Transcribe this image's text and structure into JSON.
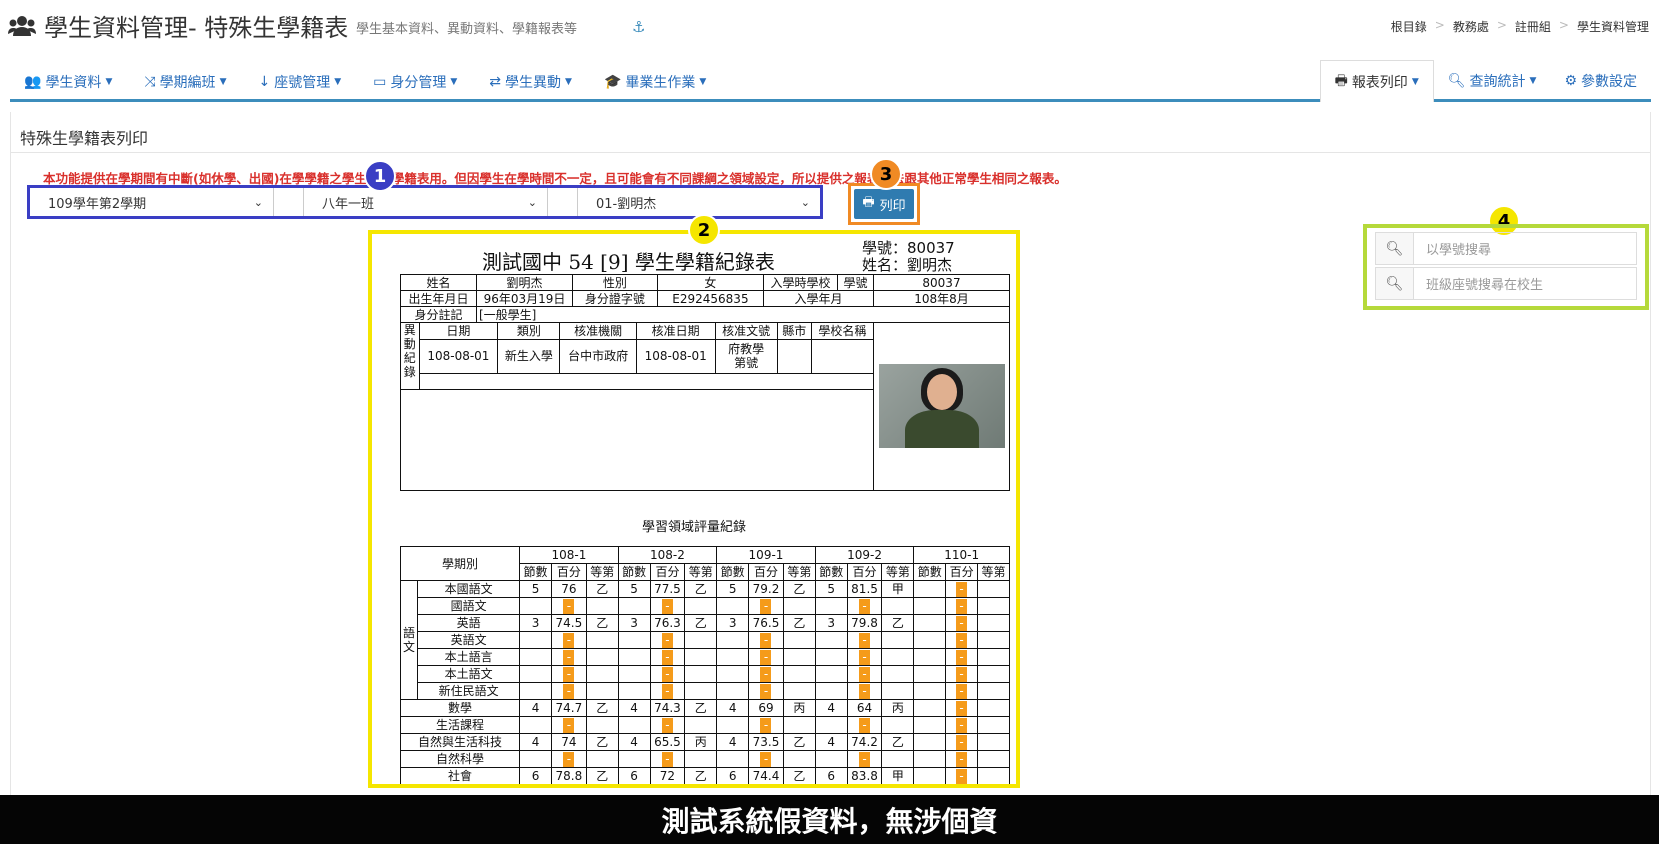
{
  "header": {
    "title": "學生資料管理- 特殊生學籍表",
    "subtitle": "學生基本資料、異動資料、學籍報表等",
    "breadcrumb": [
      "根目錄",
      "教務處",
      "註冊組",
      "學生資料管理"
    ]
  },
  "nav": {
    "left": [
      "學生資料",
      "學期編班",
      "座號管理",
      "身分管理",
      "學生異動",
      "畢業生作業"
    ],
    "right": [
      "報表列印",
      "查詢統計",
      "參數設定"
    ]
  },
  "panel": {
    "title": "特殊生學籍表列印",
    "notice": "本功能提供在學期間有中斷(如休學、出國)在學學籍之學生列印學籍表用。但因學生在學時間不一定，且可能會有不同課綱之領域設定，所以提供之報表無法跟其他正常學生相同之報表。",
    "selects": {
      "term": "109學年第2學期",
      "class": "八年一班",
      "student": "01-劉明杰"
    },
    "print_label": "列印",
    "search": {
      "by_id": "以學號搜尋",
      "by_seat": "班級座號搜尋在校生"
    }
  },
  "badges": [
    "1",
    "2",
    "3",
    "4"
  ],
  "doc": {
    "title": "測試國中 54 [9] 學生學籍紀錄表",
    "id_line": "學號：80037",
    "name_line": "姓名：劉明杰",
    "basic": {
      "name_label": "姓名",
      "name": "劉明杰",
      "sex_label": "性別",
      "sex": "女",
      "school_label": "入學時學校",
      "id_label": "學號",
      "id": "80037",
      "birth_label": "出生年月日",
      "birth": "96年03月19日",
      "idno_label": "身分證字號",
      "idno": "E292456835",
      "enroll_label": "入學年月",
      "enroll": "108年8月",
      "status_label": "身分註記",
      "status": "[一般學生]"
    },
    "change": {
      "side": [
        "異",
        "動",
        "紀",
        "錄"
      ],
      "headers": [
        "日期",
        "類別",
        "核准機關",
        "核准日期",
        "核准文號",
        "縣市",
        "學校名稱"
      ],
      "row": [
        "108-08-01",
        "新生入學",
        "台中市政府",
        "108-08-01",
        "府教學\n第號",
        "",
        ""
      ]
    },
    "grades_title": "學習領域評量紀錄",
    "grades": {
      "term_label": "學期別",
      "terms": [
        "108-1",
        "108-2",
        "109-1",
        "109-2",
        "110-1"
      ],
      "sub": [
        "節數",
        "百分",
        "等第"
      ],
      "group_label": "語文",
      "rows": [
        {
          "name": "本國語文",
          "g": true,
          "v": [
            [
              "5",
              "76",
              "乙"
            ],
            [
              "5",
              "77.5",
              "乙"
            ],
            [
              "5",
              "79.2",
              "乙"
            ],
            [
              "5",
              "81.5",
              "甲"
            ],
            [
              "",
              "-",
              ""
            ]
          ]
        },
        {
          "name": "國語文",
          "g": true,
          "v": [
            [
              "",
              "-",
              ""
            ],
            [
              "",
              "-",
              ""
            ],
            [
              "",
              "-",
              ""
            ],
            [
              "",
              "-",
              ""
            ],
            [
              "",
              "-",
              ""
            ]
          ]
        },
        {
          "name": "英語",
          "g": true,
          "v": [
            [
              "3",
              "74.5",
              "乙"
            ],
            [
              "3",
              "76.3",
              "乙"
            ],
            [
              "3",
              "76.5",
              "乙"
            ],
            [
              "3",
              "79.8",
              "乙"
            ],
            [
              "",
              "-",
              ""
            ]
          ]
        },
        {
          "name": "英語文",
          "g": true,
          "v": [
            [
              "",
              "-",
              ""
            ],
            [
              "",
              "-",
              ""
            ],
            [
              "",
              "-",
              ""
            ],
            [
              "",
              "-",
              ""
            ],
            [
              "",
              "-",
              ""
            ]
          ]
        },
        {
          "name": "本土語言",
          "g": true,
          "v": [
            [
              "",
              "-",
              ""
            ],
            [
              "",
              "-",
              ""
            ],
            [
              "",
              "-",
              ""
            ],
            [
              "",
              "-",
              ""
            ],
            [
              "",
              "-",
              ""
            ]
          ]
        },
        {
          "name": "本土語文",
          "g": true,
          "v": [
            [
              "",
              "-",
              ""
            ],
            [
              "",
              "-",
              ""
            ],
            [
              "",
              "-",
              ""
            ],
            [
              "",
              "-",
              ""
            ],
            [
              "",
              "-",
              ""
            ]
          ]
        },
        {
          "name": "新住民語文",
          "g": true,
          "v": [
            [
              "",
              "-",
              ""
            ],
            [
              "",
              "-",
              ""
            ],
            [
              "",
              "-",
              ""
            ],
            [
              "",
              "-",
              ""
            ],
            [
              "",
              "-",
              ""
            ]
          ]
        },
        {
          "name": "數學",
          "g": false,
          "v": [
            [
              "4",
              "74.7",
              "乙"
            ],
            [
              "4",
              "74.3",
              "乙"
            ],
            [
              "4",
              "69",
              "丙"
            ],
            [
              "4",
              "64",
              "丙"
            ],
            [
              "",
              "-",
              ""
            ]
          ]
        },
        {
          "name": "生活課程",
          "g": false,
          "v": [
            [
              "",
              "-",
              ""
            ],
            [
              "",
              "-",
              ""
            ],
            [
              "",
              "-",
              ""
            ],
            [
              "",
              "-",
              ""
            ],
            [
              "",
              "-",
              ""
            ]
          ]
        },
        {
          "name": "自然與生活科技",
          "g": false,
          "v": [
            [
              "4",
              "74",
              "乙"
            ],
            [
              "4",
              "65.5",
              "丙"
            ],
            [
              "4",
              "73.5",
              "乙"
            ],
            [
              "4",
              "74.2",
              "乙"
            ],
            [
              "",
              "-",
              ""
            ]
          ]
        },
        {
          "name": "自然科學",
          "g": false,
          "v": [
            [
              "",
              "-",
              ""
            ],
            [
              "",
              "-",
              ""
            ],
            [
              "",
              "-",
              ""
            ],
            [
              "",
              "-",
              ""
            ],
            [
              "",
              "-",
              ""
            ]
          ]
        },
        {
          "name": "社會",
          "g": false,
          "v": [
            [
              "6",
              "78.8",
              "乙"
            ],
            [
              "6",
              "72",
              "乙"
            ],
            [
              "6",
              "74.4",
              "乙"
            ],
            [
              "6",
              "83.8",
              "甲"
            ],
            [
              "",
              "-",
              ""
            ]
          ]
        }
      ]
    }
  },
  "footer": "測試系統假資料，無涉個資",
  "colors": {
    "accent": "#3c8dbc",
    "notice": "#d9302c",
    "badge1": "#3a3ec4",
    "badge2": "#f5e600",
    "badge3": "#f08a24",
    "badge4": "#b5d93a",
    "dash": "#f59b1a"
  }
}
